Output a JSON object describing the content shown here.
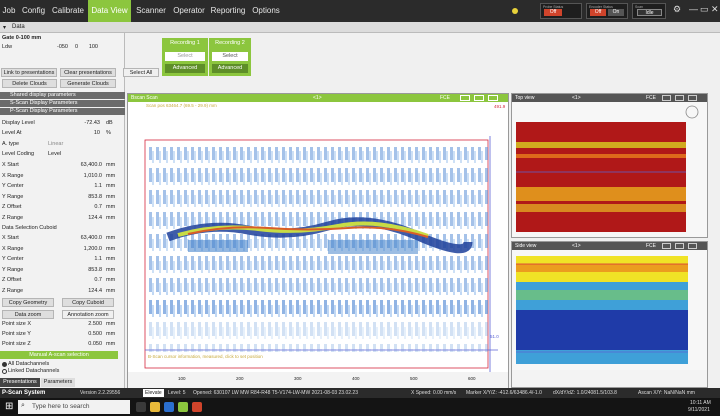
{
  "menu": {
    "items": [
      "Job",
      "Config",
      "Calibrate",
      "Data View",
      "Scanner",
      "Operator",
      "Reporting",
      "Options"
    ],
    "active": "Data View"
  },
  "status": {
    "box1": {
      "caption": "Probe Status",
      "value": "Off"
    },
    "box2": {
      "caption": "Encoder Status",
      "value_off": "Off",
      "value_on": "On"
    },
    "box3": {
      "caption": "Scan",
      "value": "Idle"
    }
  },
  "data_header": {
    "title": "Data"
  },
  "gate": {
    "title": "Gate 0-100 mm",
    "lsw_label": "Ldw",
    "from": "-050",
    "to": "0",
    "to2": "100"
  },
  "recording": {
    "rec1": {
      "title": "Recording 1",
      "select": "Select",
      "advanced": "Advanced"
    },
    "rec2": {
      "title": "Recording 2",
      "select": "Select",
      "advanced": "Advanced"
    }
  },
  "left": {
    "link_label": "Link to presentations",
    "clear_label": "Clear presentations",
    "select_all": "Select All",
    "delete_clouds": "Delete Clouds",
    "generate_clouds": "Generate Clouds",
    "sections": [
      "Shared display parameters",
      "S-Scan Display Parameters",
      "P-Scan Display Parameters"
    ],
    "display_level": {
      "label": "Display Level",
      "value": "-72.43",
      "unit": "dB"
    },
    "level_at": {
      "label": "Level At",
      "value": "10",
      "unit": "%"
    },
    "a_type": {
      "label": "A. type",
      "value": "Linear"
    },
    "level_coding": {
      "label": "Level Coding",
      "value": "Level"
    },
    "rows1": [
      {
        "label": "X Start",
        "value": "63,400.0",
        "unit": "mm"
      },
      {
        "label": "X Range",
        "value": "1,010.0",
        "unit": "mm"
      },
      {
        "label": "Y Center",
        "value": "1.1",
        "unit": "mm"
      },
      {
        "label": "Y Range",
        "value": "853.8",
        "unit": "mm"
      },
      {
        "label": "Z Offset",
        "value": "0.7",
        "unit": "mm"
      },
      {
        "label": "Z Range",
        "value": "124.4",
        "unit": "mm"
      }
    ],
    "cuboid_title": "Data Selection Cuboid",
    "rows2": [
      {
        "label": "X Start",
        "value": "63,400.0",
        "unit": "mm"
      },
      {
        "label": "X Range",
        "value": "1,200.0",
        "unit": "mm"
      },
      {
        "label": "Y Center",
        "value": "1.1",
        "unit": "mm"
      },
      {
        "label": "Y Range",
        "value": "853.8",
        "unit": "mm"
      },
      {
        "label": "Z Offset",
        "value": "0.7",
        "unit": "mm"
      },
      {
        "label": "Z Range",
        "value": "124.4",
        "unit": "mm"
      }
    ],
    "copy_geometry": "Copy Geometry",
    "copy_cuboid": "Copy Cuboid",
    "data_zoom": "Data zoom",
    "annotation_zoom": "Annotation zoom",
    "point_sizes": [
      {
        "label": "Point size X",
        "value": "2.500",
        "unit": "mm"
      },
      {
        "label": "Point size Y",
        "value": "0.500",
        "unit": "mm"
      },
      {
        "label": "Point size Z",
        "value": "0.050",
        "unit": "mm"
      }
    ],
    "manual_ascan": "Manual A-scan selection",
    "radio_all": "All Datachannels",
    "radio_linked": "Linked Datachannels",
    "tab_presentations": "Presentations",
    "tab_parameters": "Parameters"
  },
  "views": {
    "main": {
      "title": "Bscan Scan",
      "zoom": "<1>",
      "fce": "FCE",
      "cursor": "Scan pos 63464.7 (69.5 - 29.9) mm",
      "bottom_note": "B-Scan cursor information, measured, click to set position",
      "r1": "491.9",
      "r2": "51.0",
      "x_ticks": [
        "100",
        "200",
        "300",
        "400",
        "500",
        "600"
      ]
    },
    "top": {
      "title": "Top view",
      "zoom": "<1>",
      "fce": "FCE"
    },
    "side": {
      "title": "Side view",
      "zoom": "<1>",
      "fce": "FCE"
    }
  },
  "statusbar": {
    "app": "P-Scan System",
    "version": "Version 2.2.29556",
    "elevate": "Elevate",
    "level": "Level: 5",
    "opened": "Opened: 630107 LW MW R84-R48 T5-V174-LW-MW 2021-08-03 23.02.23",
    "speed": "X Speed: 0.00 mm/s",
    "marker": "Marker X/Y/Z: -412.6/63486.4/-1.0",
    "dxdy": "dX/dY/dZ: 1.0/24081.5/103.8",
    "ascan": "Ascan X/Y: NaN/NaN mm"
  },
  "taskbar": {
    "search": "Type here to search",
    "time": "10:11 AM",
    "date": "9/11/2021"
  }
}
